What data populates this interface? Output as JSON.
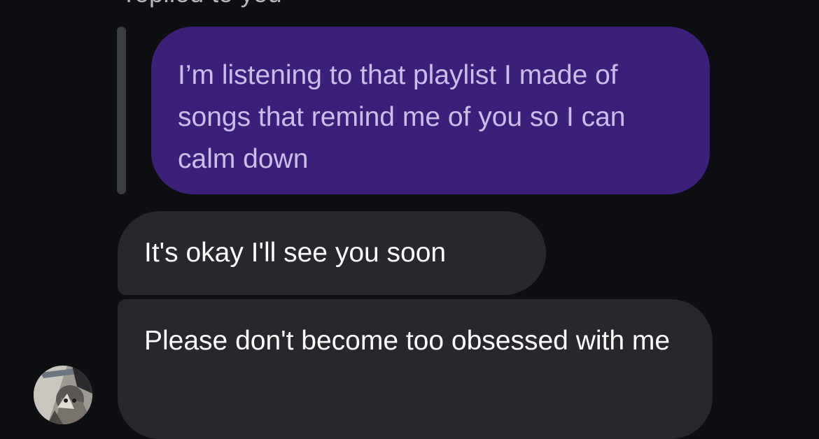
{
  "header": {
    "cutoff_text": "replied to you"
  },
  "conversation": {
    "quoted_message": {
      "text": "I’m listening to that playlist I made of songs that remind me of you so I can calm down",
      "color": "#3c1f79"
    },
    "replies": [
      {
        "text": "It's okay I'll see you soon"
      },
      {
        "text": "Please don't become too obsessed with me"
      }
    ],
    "incoming_bubble_color": "#26282d",
    "sender_avatar": {
      "icon": "cat-photo-avatar"
    }
  }
}
